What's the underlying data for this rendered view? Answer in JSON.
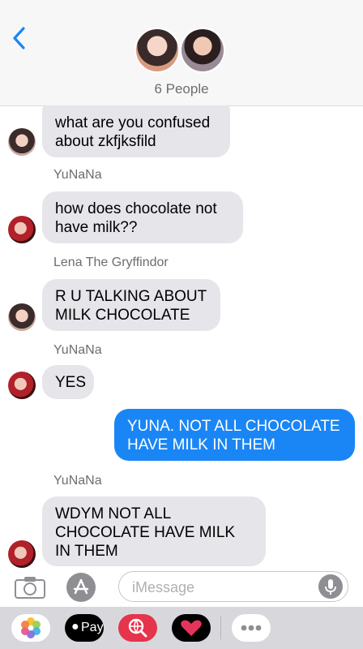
{
  "header": {
    "group_count": "6 People"
  },
  "messages": [
    {
      "sender": "",
      "text": "what are you confused about zkfjksfild",
      "from_me": false
    },
    {
      "sender": "YuNaNa",
      "text": "how does chocolate not have milk??",
      "from_me": false
    },
    {
      "sender": "Lena The Gryffindor",
      "text": "R U TALKING ABOUT MILK CHOCOLATE",
      "from_me": false
    },
    {
      "sender": "YuNaNa",
      "text": "YES",
      "from_me": false
    },
    {
      "sender": "",
      "text": "YUNA. NOT ALL CHOCOLATE HAVE MILK IN THEM",
      "from_me": true
    },
    {
      "sender": "YuNaNa",
      "text": "WDYM NOT ALL CHOCOLATE HAVE MILK IN THEM",
      "from_me": false
    }
  ],
  "input": {
    "placeholder": "iMessage"
  },
  "app_tray": {
    "items": [
      {
        "name": "photos-app-icon"
      },
      {
        "name": "apple-pay-icon",
        "label": "Pay"
      },
      {
        "name": "search-images-icon"
      },
      {
        "name": "digital-touch-icon"
      },
      {
        "name": "more-apps-icon"
      }
    ]
  },
  "colors": {
    "outgoing_bubble": "#1a86f5",
    "incoming_bubble": "#e5e5ea",
    "secondary_text": "#6d6d72"
  }
}
